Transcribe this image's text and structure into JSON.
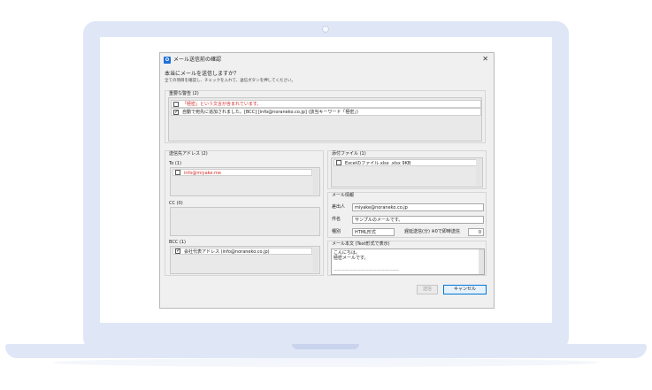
{
  "window": {
    "title": "メール送信前の確認",
    "app_icon_letter": "O",
    "close_glyph": "✕"
  },
  "header": {
    "question": "本当にメールを送信しますか？",
    "instruction": "全ての項目を確認し、チェックを入れて、送信ボタンを押してください。"
  },
  "warnings": {
    "title": "重要な警告 (2)",
    "items": [
      {
        "text": "「極密」という文言が含まれています。",
        "checked": false
      },
      {
        "text": "自動で宛先に追加されました。[BCC] [info@noraneko.co.jp] (該当キーワード「極密」)",
        "checked": true
      }
    ]
  },
  "recipients": {
    "title": "送信先アドレス (2)",
    "to": {
      "label": "To (1)",
      "items": [
        {
          "text": "info@miyake.me",
          "checked": false
        }
      ]
    },
    "cc": {
      "label": "CC (0)",
      "items": []
    },
    "bcc": {
      "label": "BCC (1)",
      "items": [
        {
          "text": "会社代表アドレス (info@noraneko.co.jp)",
          "checked": true
        }
      ]
    }
  },
  "attachments": {
    "title": "添付ファイル (1)",
    "items": [
      {
        "text": "Excelのファイル.xlsx .xlsx 9KB",
        "checked": false
      }
    ]
  },
  "mail_info": {
    "title": "メール情報",
    "sender_label": "差出人",
    "sender_value": "miyake@noraneko.co.jp",
    "subject_label": "件名",
    "subject_value": "サンプルのメールです。",
    "type_label": "種別",
    "type_value": "HTML形式",
    "delay_label": "遅延送信(分) ※0で即時送信",
    "delay_value": "0"
  },
  "body": {
    "title": "メール本文 (Text形式で表示)",
    "line1": "こんにちは。",
    "line2": "極密メールです。",
    "line3": "-----------------------------------------"
  },
  "buttons": {
    "send": "送信",
    "cancel": "キャンセル"
  },
  "colors": {
    "accent": "#0078d7",
    "warning_text": "#d42a2a",
    "frame": "#dfe7f7"
  }
}
